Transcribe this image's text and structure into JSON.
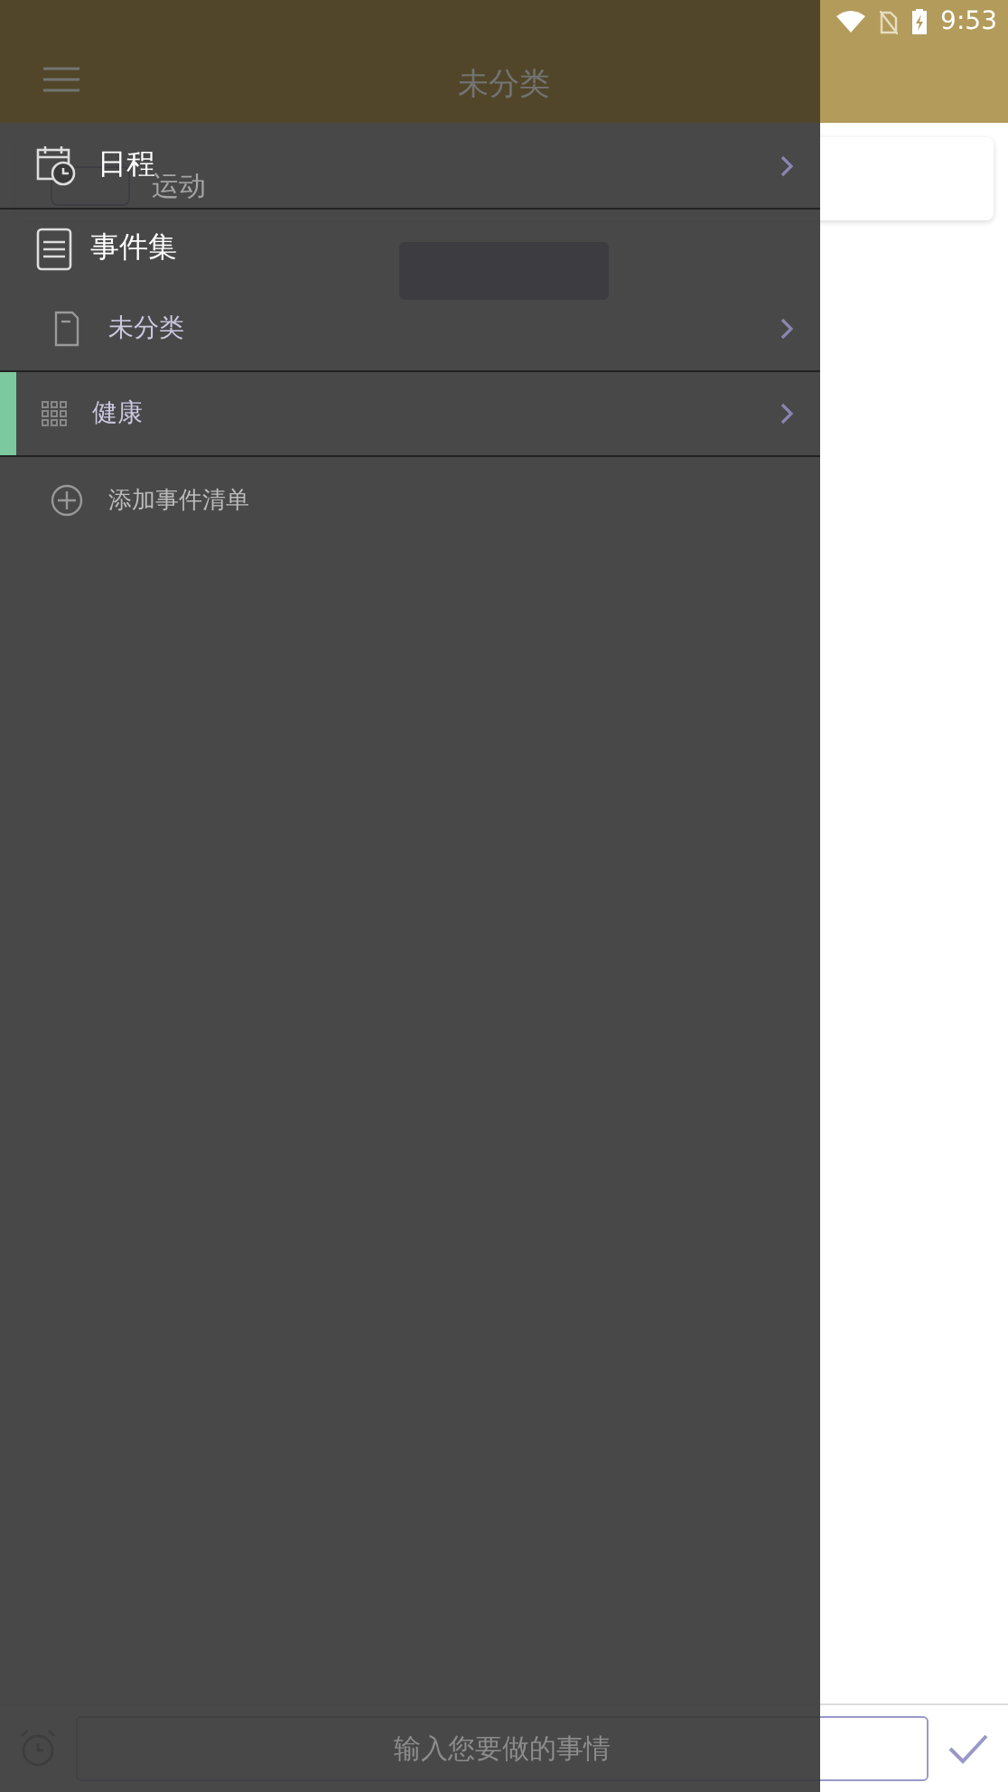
{
  "status_bar": {
    "time": "9:53"
  },
  "app_bar": {
    "title": "未分类"
  },
  "tasks": [
    {
      "title": "运动"
    }
  ],
  "input_bar": {
    "placeholder": "输入您要做的事情"
  },
  "drawer": {
    "sections": [
      {
        "kind": "schedule",
        "label": "日程",
        "chevron": true
      },
      {
        "kind": "collection",
        "label": "事件集",
        "chevron": false
      }
    ],
    "lists": [
      {
        "kind": "inbox",
        "label": "未分类"
      },
      {
        "kind": "custom",
        "label": "健康",
        "color": "#7cc9a0"
      }
    ],
    "add_label": "添加事件清单"
  }
}
